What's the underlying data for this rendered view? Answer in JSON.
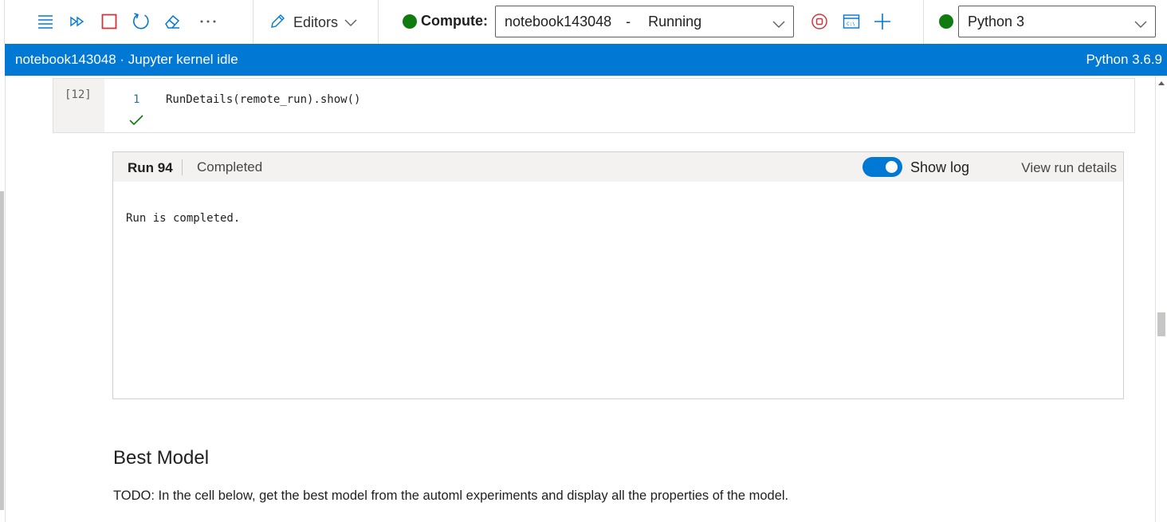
{
  "toolbar": {
    "icons": [
      "menu-lines-icon",
      "run-all-icon",
      "stop-square-icon",
      "restart-icon",
      "eraser-icon",
      "more-icon"
    ],
    "editors_label": "Editors",
    "compute_label": "Compute:",
    "compute_name": "notebook143048",
    "compute_separator": "-",
    "compute_status": "Running",
    "kernel_name": "Python 3",
    "status_color": "#107c10"
  },
  "statusbar": {
    "left_text": "notebook143048 · Jupyter kernel idle",
    "right_text": "Python 3.6.9",
    "color": "#0078d4"
  },
  "cell": {
    "execution_count": "[12]",
    "line_number": "1",
    "code": "RunDetails(remote_run).show()"
  },
  "run_widget": {
    "title": "Run 94",
    "status": "Completed",
    "toggle_label": "Show log",
    "toggle_on": true,
    "view_details": "View run details",
    "log": "Run is completed."
  },
  "markdown": {
    "heading": "Best Model",
    "text": "TODO: In the cell below, get the best model from the automl experiments and display all the properties of the model."
  }
}
